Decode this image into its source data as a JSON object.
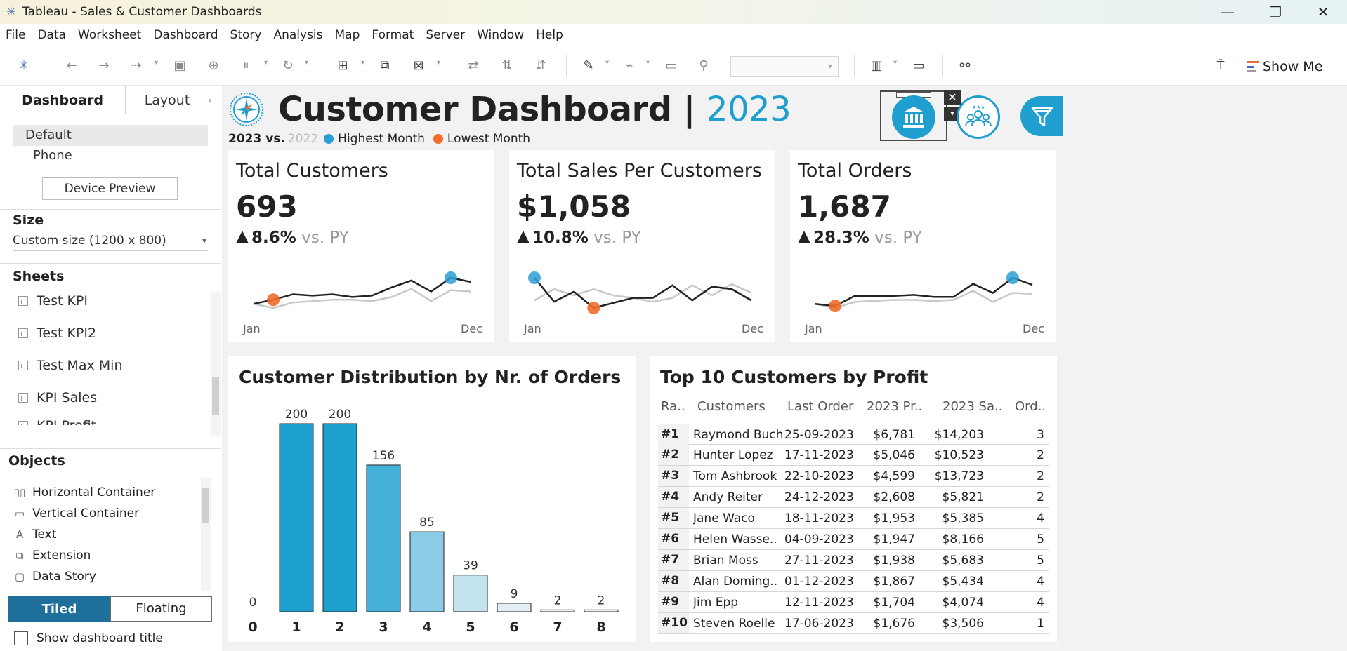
{
  "window": {
    "title": "Tableau - Sales & Customer Dashboards",
    "controls": [
      "—",
      "❐",
      "✕"
    ]
  },
  "menu": [
    "File",
    "Data",
    "Worksheet",
    "Dashboard",
    "Story",
    "Analysis",
    "Map",
    "Format",
    "Server",
    "Window",
    "Help"
  ],
  "toolbar": {
    "show_me_label": "Show Me"
  },
  "left_panel": {
    "tabs": {
      "dashboard": "Dashboard",
      "layout": "Layout"
    },
    "device": {
      "default": "Default",
      "phone": "Phone",
      "preview_button": "Device Preview"
    },
    "size": {
      "title": "Size",
      "value": "Custom size (1200 x 800)"
    },
    "sheets": {
      "title": "Sheets",
      "items": [
        "Test KPI",
        "Test KPI2",
        "Test Max Min",
        "KPI Sales",
        "KPI Profit"
      ]
    },
    "objects": {
      "title": "Objects",
      "items": [
        {
          "label": "Horizontal Container",
          "icon": "horizontal-container-icon",
          "glyph": "▯▯"
        },
        {
          "label": "Vertical Container",
          "icon": "vertical-container-icon",
          "glyph": "▭"
        },
        {
          "label": "Text",
          "icon": "text-icon",
          "glyph": "A"
        },
        {
          "label": "Extension",
          "icon": "extension-icon",
          "glyph": "⧉"
        },
        {
          "label": "Data Story",
          "icon": "data-story-icon",
          "glyph": "▢"
        }
      ]
    },
    "layout_toggle": {
      "tiled": "Tiled",
      "floating": "Floating"
    },
    "show_title_label": "Show dashboard title"
  },
  "dashboard": {
    "title": "Customer Dashboard |",
    "year": "2023",
    "legend": {
      "current": "2023 vs.",
      "previous": "2022",
      "highest": "Highest Month",
      "lowest": "Lowest Month"
    },
    "colors": {
      "accent": "#1f9fcf",
      "highest": "#2a9fd6",
      "lowest": "#f26b2a",
      "previous_line": "#c8c8c8",
      "current_line": "#222222"
    },
    "kpis": [
      {
        "title": "Total Customers",
        "value": "693",
        "delta": "8.6%",
        "vs": "vs. PY",
        "start_label": "Jan",
        "end_label": "Dec",
        "current": [
          46,
          49,
          53,
          52,
          53,
          51,
          52,
          58,
          63,
          55,
          65,
          62
        ],
        "previous": [
          46,
          43,
          47,
          48,
          49,
          49,
          48,
          51,
          57,
          48,
          56,
          55
        ],
        "high_index": 10,
        "low_index": 1
      },
      {
        "title": "Total Sales Per Customers",
        "value": "$1,058",
        "vs": "vs. PY",
        "delta": "10.8%",
        "start_label": "Jan",
        "end_label": "Dec",
        "current": [
          1130,
          1035,
          1075,
          1010,
          1030,
          1050,
          1050,
          1100,
          1040,
          1095,
          1085,
          1040
        ],
        "previous": [
          1040,
          1085,
          1060,
          1085,
          1060,
          1050,
          1035,
          1050,
          1100,
          1060,
          1105,
          1070
        ],
        "high_index": 0,
        "low_index": 3
      },
      {
        "title": "Total Orders",
        "value": "1,687",
        "delta": "28.3%",
        "vs": "vs. PY",
        "start_label": "Jan",
        "end_label": "Dec",
        "current": [
          115,
          113,
          123,
          123,
          123,
          124,
          122,
          122,
          135,
          126,
          141,
          134
        ],
        "previous": [
          115,
          111,
          117,
          118,
          119,
          119,
          118,
          119,
          128,
          117,
          126,
          125
        ],
        "high_index": 10,
        "low_index": 1
      }
    ],
    "distribution": {
      "title": "Customer Distribution by Nr. of Orders",
      "chart_data": {
        "type": "bar",
        "categories": [
          "0",
          "1",
          "2",
          "3",
          "4",
          "5",
          "6",
          "7",
          "8"
        ],
        "values": [
          0,
          200,
          200,
          156,
          85,
          39,
          9,
          2,
          2
        ],
        "title": "Customer Distribution by Nr. of Orders",
        "ylim": [
          0,
          200
        ],
        "grid": false
      }
    },
    "top10": {
      "title": "Top 10 Customers by Profit",
      "columns": [
        "Ra..",
        "Customers",
        "Last Order",
        "2023 Pr..",
        "2023 Sa..",
        "Ord.."
      ],
      "rows": [
        [
          "#1",
          "Raymond Buch",
          "25-09-2023",
          "$6,781",
          "$14,203",
          "3"
        ],
        [
          "#2",
          "Hunter Lopez",
          "17-11-2023",
          "$5,046",
          "$10,523",
          "2"
        ],
        [
          "#3",
          "Tom Ashbrook",
          "22-10-2023",
          "$4,599",
          "$13,723",
          "2"
        ],
        [
          "#4",
          "Andy Reiter",
          "24-12-2023",
          "$2,608",
          "$5,821",
          "2"
        ],
        [
          "#5",
          "Jane Waco",
          "18-11-2023",
          "$1,953",
          "$5,385",
          "4"
        ],
        [
          "#6",
          "Helen Wasse..",
          "04-09-2023",
          "$1,947",
          "$8,166",
          "5"
        ],
        [
          "#7",
          "Brian Moss",
          "27-11-2023",
          "$1,938",
          "$5,683",
          "5"
        ],
        [
          "#8",
          "Alan Doming..",
          "01-12-2023",
          "$1,867",
          "$5,434",
          "4"
        ],
        [
          "#9",
          "Jim Epp",
          "12-11-2023",
          "$1,704",
          "$4,074",
          "4"
        ],
        [
          "#10",
          "Steven Roelle",
          "17-06-2023",
          "$1,676",
          "$3,506",
          "1"
        ]
      ]
    }
  }
}
